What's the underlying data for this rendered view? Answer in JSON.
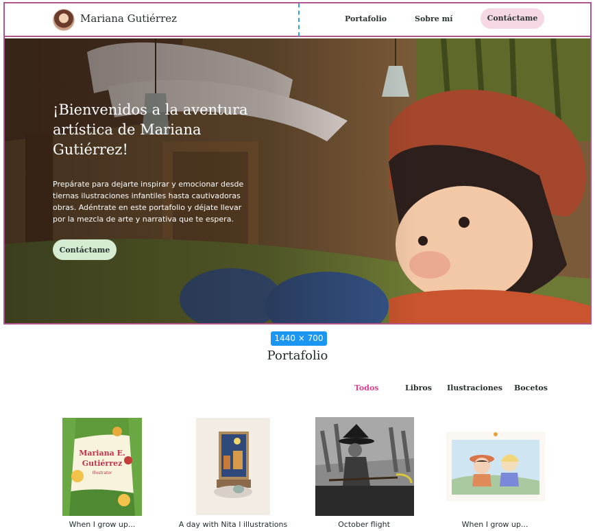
{
  "header": {
    "brand": "Mariana Gutiérrez",
    "nav": {
      "portfolio": "Portafolio",
      "about": "Sobre mí",
      "contact": "Contáctame"
    }
  },
  "hero": {
    "title": "¡Bienvenidos a la aventura artística de Mariana Gutiérrez!",
    "text": "Prepárate para dejarte inspirar y emocionar desde tiernas ilustraciones infantiles hasta cautivadoras obras. Adéntrate en este portafolio y déjate llevar por la mezcla de arte y narrativa que te espera.",
    "button": "Contáctame"
  },
  "size_badge": "1440 × 700",
  "portfolio": {
    "title": "Portafolio",
    "filters": [
      "Todos",
      "Libros",
      "Ilustraciones",
      "Bocetos"
    ],
    "active_filter": "Todos",
    "items": [
      {
        "caption": "When I grow up...",
        "cover_text": "Mariana E. Gutiérrez",
        "cover_subtitle": "Illustrator"
      },
      {
        "caption": "A day with Nita I illustrations"
      },
      {
        "caption": "October flight"
      },
      {
        "caption": "When I grow up..."
      }
    ]
  },
  "colors": {
    "accent_pink": "#e0408e",
    "contact_pill": "#f6d7e6",
    "hero_button": "#d6ecd2",
    "frame_outline": "#b0558f",
    "badge_blue": "#1b96f3"
  },
  "icons": {
    "avatar": "avatar-portrait"
  }
}
